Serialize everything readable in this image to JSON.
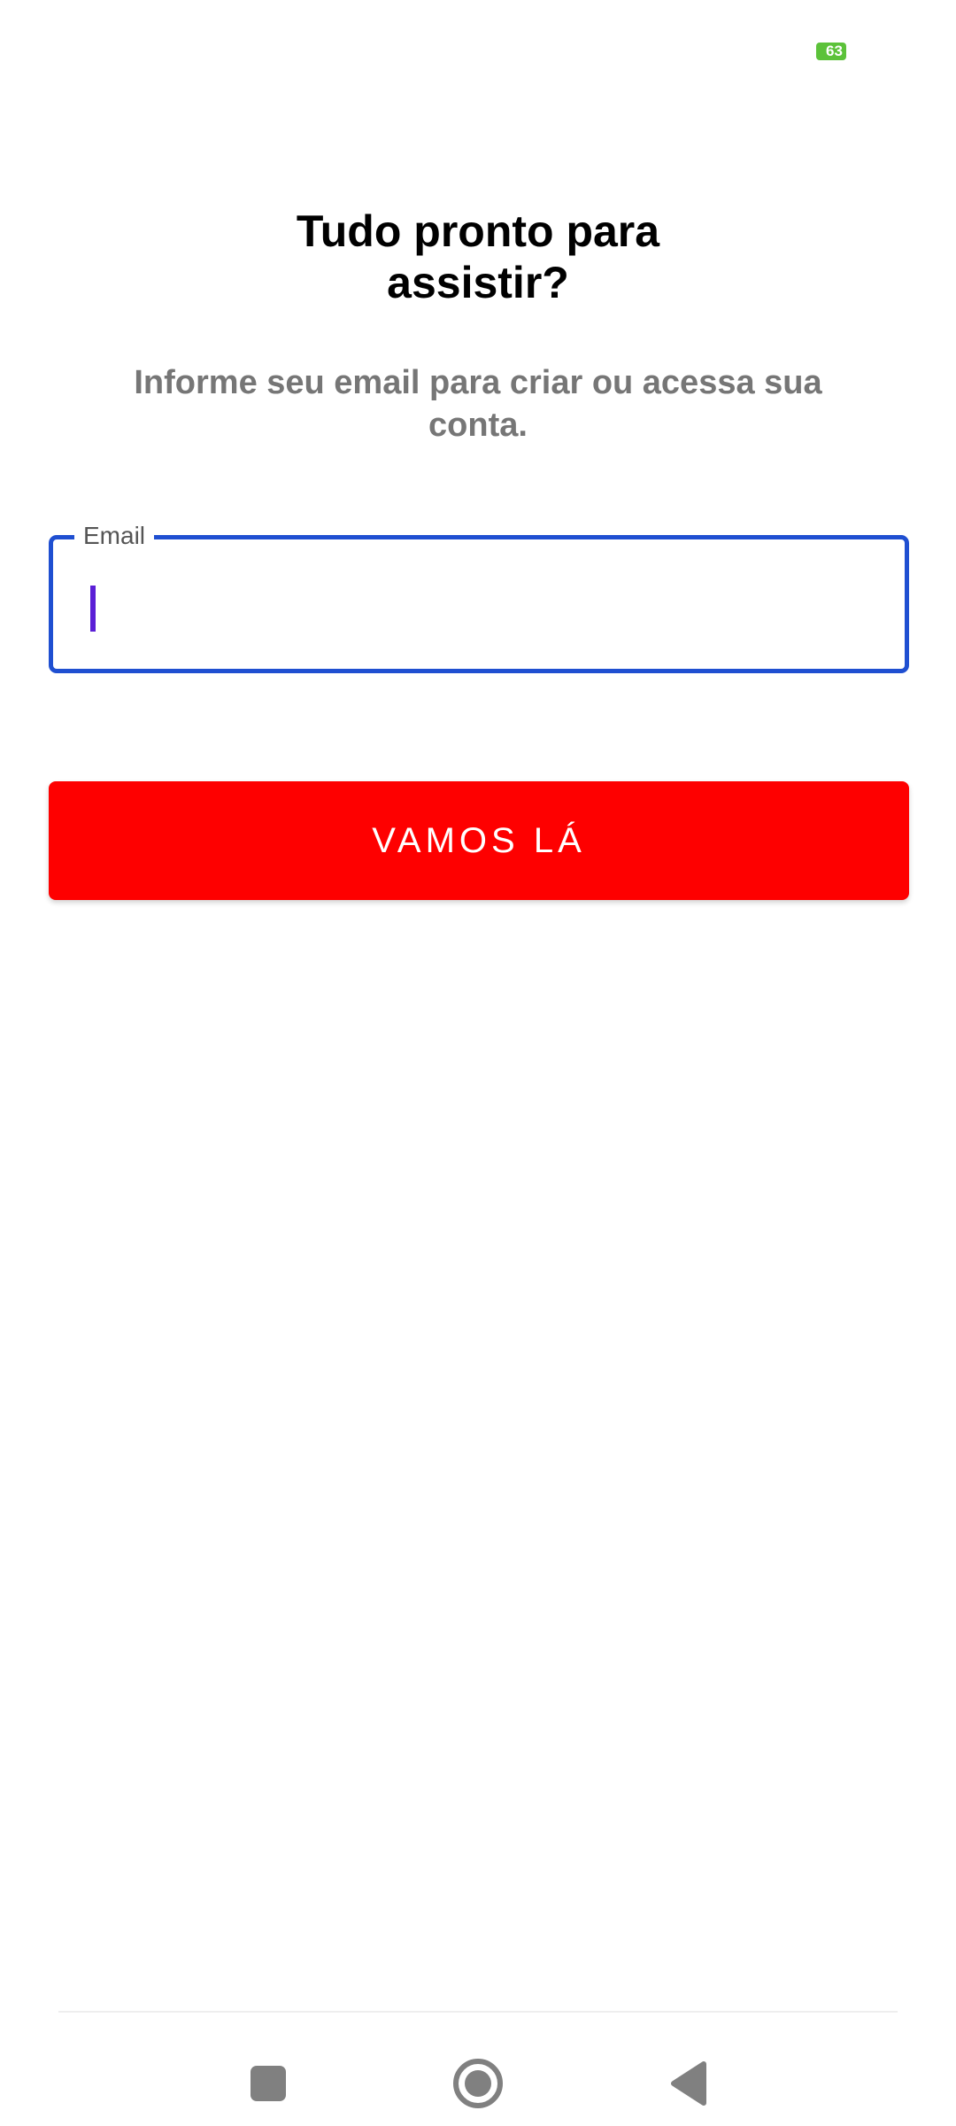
{
  "status_bar": {
    "battery_level": "63",
    "battery_color": "#5cc23a"
  },
  "onboarding": {
    "title_line1": "Tudo pronto para",
    "title_line2": "assistir?",
    "subtitle": "Informe seu email para criar ou acessa sua conta.",
    "email_label": "Email",
    "email_value": "",
    "email_focus_color": "#1f4fd1",
    "submit_label": "VAMOS LÁ",
    "submit_color": "#fe0000"
  },
  "navigation": {
    "icons": [
      "recents-icon",
      "home-icon",
      "back-icon"
    ]
  }
}
